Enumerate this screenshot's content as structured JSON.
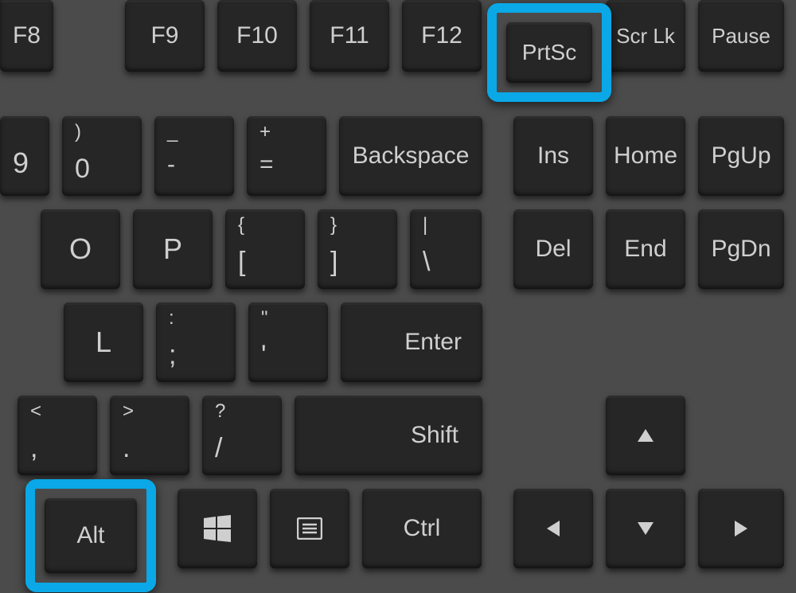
{
  "rows": {
    "function": {
      "f8": "F8",
      "f9": "F9",
      "f10": "F10",
      "f11": "F11",
      "f12": "F12",
      "prtsc": "PrtSc",
      "scrlk": "Scr Lk",
      "pause": "Pause"
    },
    "number": {
      "nine_main": "9",
      "zero_shift": ")",
      "zero_main": "0",
      "minus_shift": "_",
      "minus_main": "-",
      "equals_shift": "+",
      "equals_main": "=",
      "backspace": "Backspace",
      "ins": "Ins",
      "home": "Home",
      "pgup": "PgUp"
    },
    "qrow": {
      "o": "O",
      "p": "P",
      "lb_shift": "{",
      "lb_main": "[",
      "rb_shift": "}",
      "rb_main": "]",
      "back_shift": "|",
      "back_main": "\\",
      "del": "Del",
      "end": "End",
      "pgdn": "PgDn"
    },
    "home": {
      "l": "L",
      "semi_shift": ":",
      "semi_main": ";",
      "quote_shift": "\"",
      "quote_main": "'",
      "enter": "Enter"
    },
    "zrow": {
      "comma_shift": "<",
      "comma_main": ",",
      "period_shift": ">",
      "period_main": ".",
      "slash_shift": "?",
      "slash_main": "/",
      "shift": "Shift"
    },
    "bottom": {
      "alt": "Alt",
      "ctrl": "Ctrl"
    }
  },
  "highlight_color": "#0aa8e6"
}
